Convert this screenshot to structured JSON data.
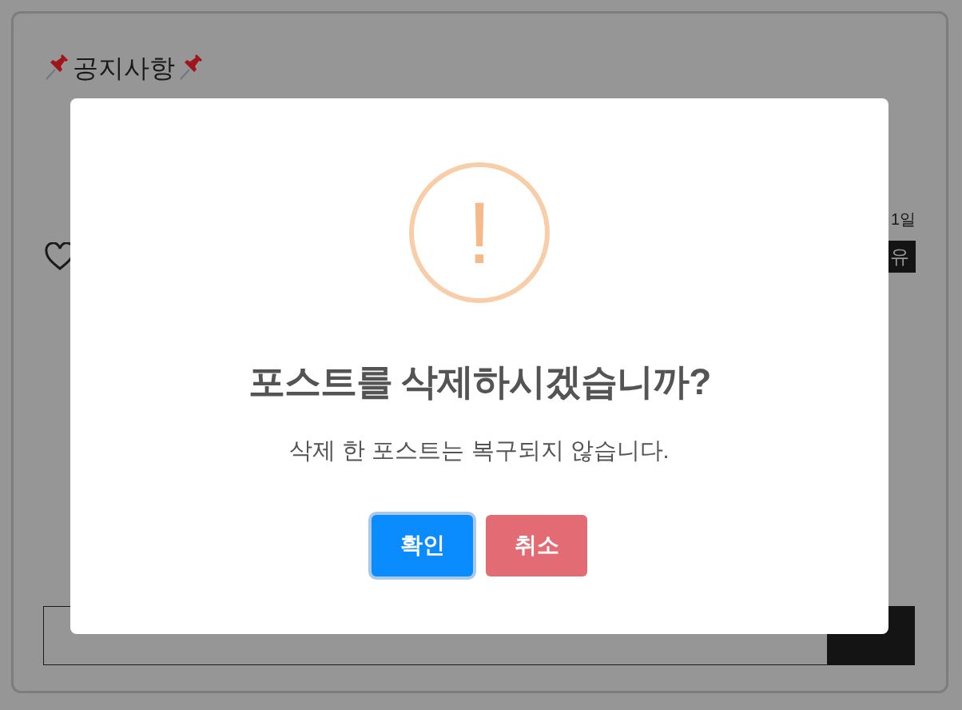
{
  "notice": {
    "title": "공지사항",
    "date": "1일",
    "action_button": "유"
  },
  "dialog": {
    "title": "포스트를 삭제하시겠습니까?",
    "message": "삭제 한 포스트는 복구되지 않습니다.",
    "icon_text": "!",
    "buttons": [
      {
        "label": "확인",
        "kind": "confirm",
        "focused": true
      },
      {
        "label": "취소",
        "kind": "cancel",
        "focused": false
      }
    ]
  }
}
